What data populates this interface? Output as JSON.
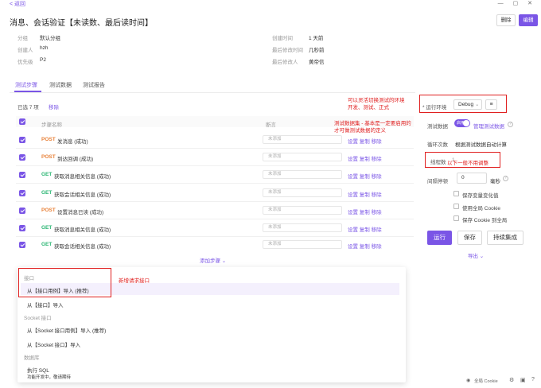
{
  "topbar": {
    "back_label": "< 返回",
    "window_controls": "— ▢ ✕"
  },
  "header": {
    "title": "消息、会话验证【未读数、最后读时间】",
    "delete_label": "删除",
    "edit_label": "编辑"
  },
  "meta": [
    {
      "key": "分组",
      "value": "默认分组"
    },
    {
      "key": "创建人",
      "value": "hzh"
    },
    {
      "key": "优先级",
      "value": "P2"
    },
    {
      "key": "创建时间",
      "value": "1 天前"
    },
    {
      "key": "最后修改时间",
      "value": "几秒前"
    },
    {
      "key": "最后修改人",
      "value": "黄帝信"
    }
  ],
  "tabs": [
    {
      "label": "测试步骤",
      "active": true
    },
    {
      "label": "测试数据",
      "active": false
    },
    {
      "label": "测试报告",
      "active": false
    }
  ],
  "steps_panel": {
    "selected_text": "已选 7 项",
    "remove_label": "移除",
    "col_name": "步骤名称",
    "col_assert": "断言",
    "add_step_label": "添加步骤 ⌄",
    "steps": [
      {
        "method": "POST",
        "name": "发消息 (成功)",
        "assert": "未添加",
        "actions": "设置 复制 移除"
      },
      {
        "method": "POST",
        "name": "到达回调 (成功)",
        "assert": "未添加",
        "actions": "设置 复制 移除"
      },
      {
        "method": "GET",
        "name": "获取消息相关信息 (成功)",
        "assert": "未添加",
        "actions": "设置 复制 移除"
      },
      {
        "method": "GET",
        "name": "获取会话相关信息 (成功)",
        "assert": "未添加",
        "actions": "设置 复制 移除"
      },
      {
        "method": "POST",
        "name": "设置消息已读 (成功)",
        "assert": "未添加",
        "actions": "设置 复制 移除"
      },
      {
        "method": "GET",
        "name": "获取消息相关信息 (成功)",
        "assert": "未添加",
        "actions": "设置 复制 移除"
      },
      {
        "method": "GET",
        "name": "获取会话相关信息 (成功)",
        "assert": "未添加",
        "actions": "设置 复制 移除"
      }
    ]
  },
  "annotations": {
    "env_note_1": "可以灵活切换测试的环境",
    "env_note_2": "开发、测试、正式",
    "data_note_1": "测试数据集 - 基本是一定要启用的",
    "data_note_2": "才可做测试数据的定义",
    "thread_note": "以下一般不用调整",
    "dropdown_note": "新增请求接口"
  },
  "run_panel": {
    "env_label": "* 运行环境",
    "env_value": "Debug",
    "menu_icon": "≡",
    "test_data_label": "测试数据",
    "toggle_text": "启用",
    "manage_data_link": "管理测试数据",
    "loop_label": "循环次数",
    "loop_value": "根据测试数据自动计算",
    "threads_label": "线程数",
    "threads_value": "1",
    "interval_label": "间隔停顿",
    "interval_value": "0",
    "interval_unit": "毫秒",
    "options": [
      "保存变量变化值",
      "使用全局 Cookie",
      "保存 Cookie 到全局"
    ],
    "run_label": "运行",
    "save_label": "保存",
    "ci_label": "持续集成",
    "export_label": "导出 ⌄"
  },
  "dropdown": {
    "group_api": "接口",
    "import_case": "从【接口用例】导入 (推荐)",
    "import_api": "从【接口】导入",
    "group_socket": "Socket 接口",
    "import_socket_case": "从【Socket 接口用例】导入 (推荐)",
    "import_socket": "从【Socket 接口】导入",
    "group_db": "数据库",
    "exec_sql": "执行 SQL",
    "exec_sql_desc": "功能开发中，敬请期待"
  },
  "bottombar": {
    "cookie_label": "全局 Cookie"
  },
  "colors": {
    "accent": "#7a55e6",
    "annotation": "#e02020",
    "post": "#e8823a",
    "get": "#2bb673"
  }
}
